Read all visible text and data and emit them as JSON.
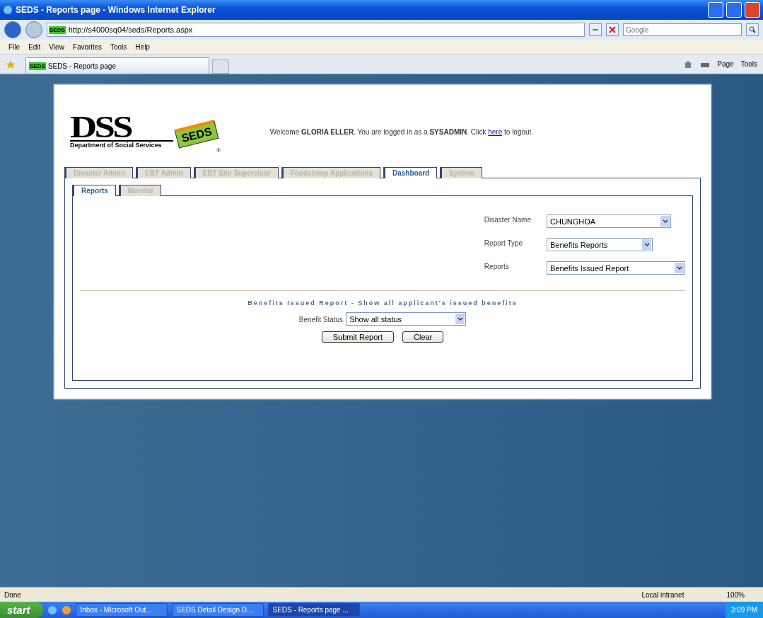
{
  "window": {
    "title": "SEDS - Reports page - Windows Internet Explorer"
  },
  "address_bar": {
    "logo": "SEDS",
    "url": "http://s4000sq04/seds/Reports.aspx",
    "search_placeholder": "Google"
  },
  "menu": [
    "File",
    "Edit",
    "View",
    "Favorites",
    "Tools",
    "Help"
  ],
  "browser_tab": {
    "logo": "SEDS",
    "title": "SEDS - Reports page"
  },
  "command_bar": [
    "Page",
    "Tools"
  ],
  "page": {
    "logo": {
      "mark": "DSS",
      "caption": "Department of Social Services",
      "badge": "SEDS",
      "badge_mark": "®"
    },
    "welcome": {
      "text": "Welcome **GLORIA ELLER**. You are logged in as a **SYSADMIN**. Click ",
      "link": "here",
      "after": " to logout."
    },
    "tabs": [
      {
        "label": "Disaster Admin",
        "selected": false
      },
      {
        "label": "EBT Admin",
        "selected": false
      },
      {
        "label": "EBT Site Supervisor",
        "selected": false
      },
      {
        "label": "Foodstamp Applications",
        "selected": false
      },
      {
        "label": "Dashboard",
        "selected": true
      },
      {
        "label": "System",
        "selected": false
      }
    ],
    "subtabs": [
      {
        "label": "Reports",
        "selected": true
      },
      {
        "label": "Monitor",
        "selected": false
      }
    ],
    "filters": [
      {
        "label": "Disaster Name",
        "value": "CHUNGHOA"
      },
      {
        "label": "Report Type",
        "value": "Benefits Reports"
      },
      {
        "label": "Reports",
        "value": "Benefits Issued Report"
      }
    ],
    "report_heading": "Benefits Issued Report - Show all applicant's issued benefits",
    "benefit_status": {
      "label": "Benefit Status",
      "value": "Show all status"
    },
    "buttons": [
      "Submit Report",
      "Clear"
    ]
  },
  "status_bar": {
    "text": "Done",
    "zone": "Local intranet",
    "zoom": "100%"
  },
  "taskbar": {
    "start": "start",
    "tasks": [
      {
        "label": "Inbox - Microsoft Out...",
        "selected": false
      },
      {
        "label": "SEDS Detail Design D...",
        "selected": false
      },
      {
        "label": "SEDS - Reports page ...",
        "selected": true
      }
    ],
    "clock": "3:09 PM"
  }
}
